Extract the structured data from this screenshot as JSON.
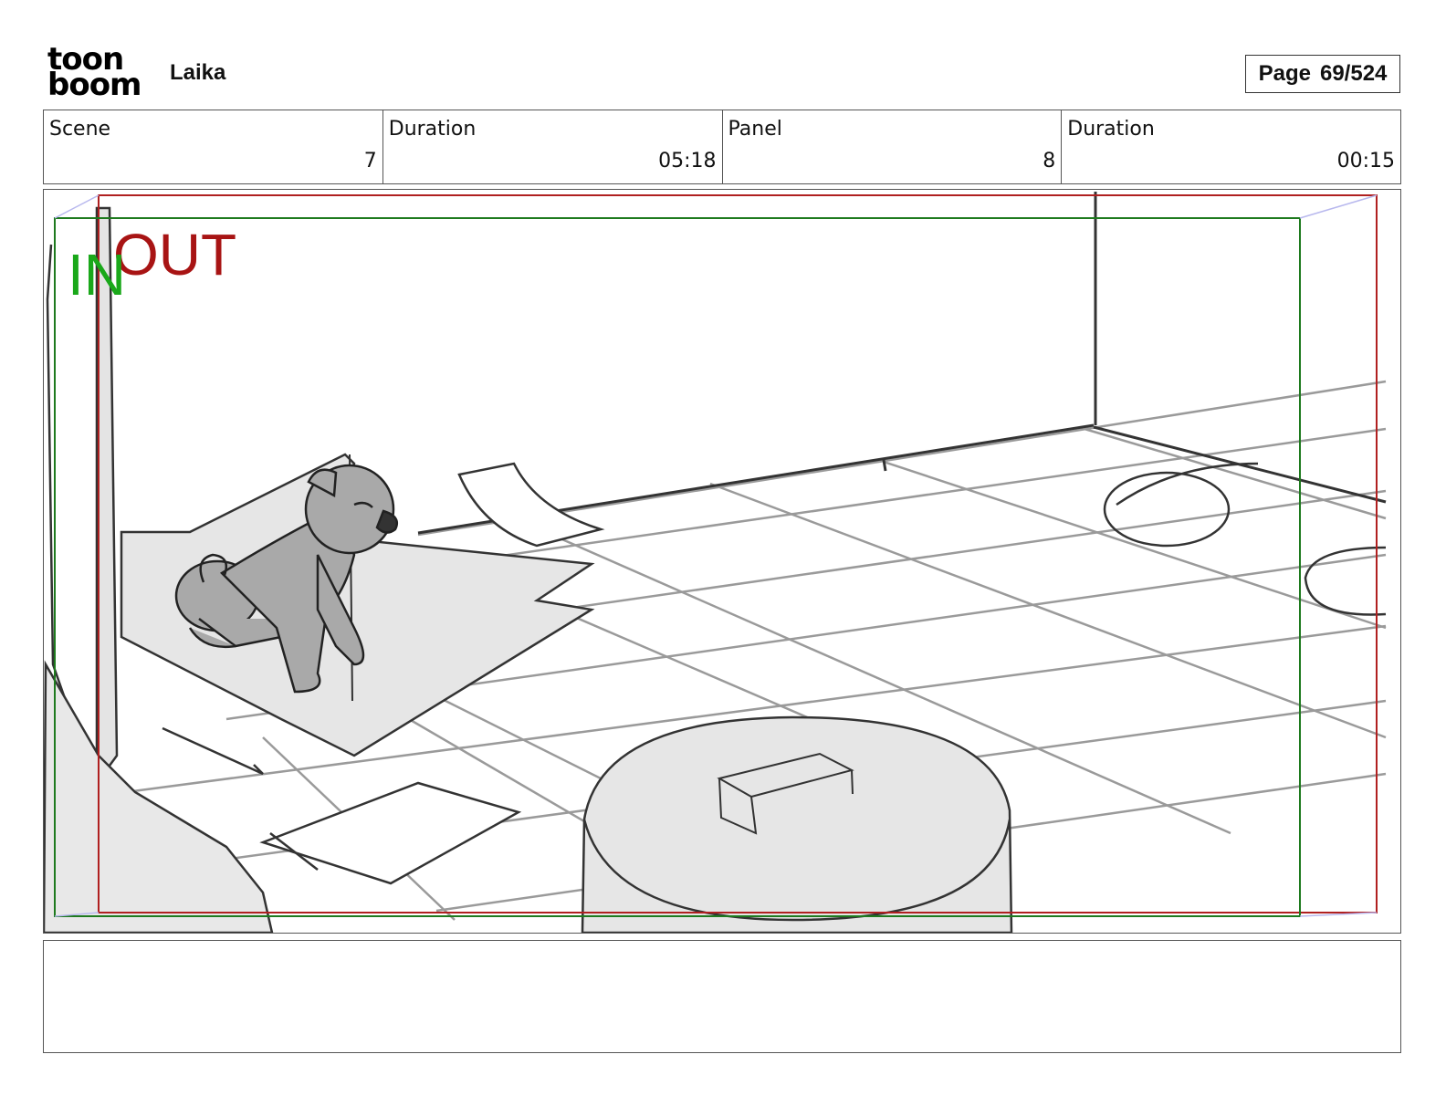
{
  "header": {
    "logo_top": "toon",
    "logo_bottom": "boom",
    "project_title": "Laika",
    "page_label": "Page",
    "page_number": "69/524"
  },
  "info": {
    "scene_label": "Scene",
    "scene_value": "7",
    "scene_duration_label": "Duration",
    "scene_duration_value": "05:18",
    "panel_label": "Panel",
    "panel_value": "8",
    "panel_duration_label": "Duration",
    "panel_duration_value": "00:15"
  },
  "panel": {
    "in_label": "IN",
    "out_label": "OUT",
    "in_color": "#1aa81a",
    "out_color": "#a81414"
  },
  "notes": {
    "text": ""
  }
}
